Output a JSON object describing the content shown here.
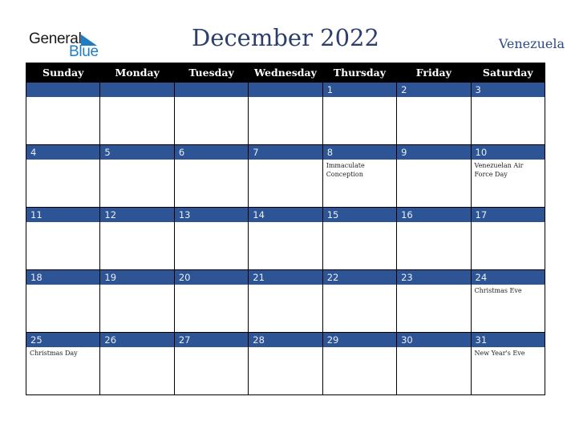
{
  "logo": {
    "line1": "General",
    "line2": "Blue"
  },
  "header": {
    "title": "December 2022",
    "country": "Venezuela"
  },
  "weekdays": [
    "Sunday",
    "Monday",
    "Tuesday",
    "Wednesday",
    "Thursday",
    "Friday",
    "Saturday"
  ],
  "weeks": [
    [
      {
        "day": "",
        "note": ""
      },
      {
        "day": "",
        "note": ""
      },
      {
        "day": "",
        "note": ""
      },
      {
        "day": "",
        "note": ""
      },
      {
        "day": "1",
        "note": ""
      },
      {
        "day": "2",
        "note": ""
      },
      {
        "day": "3",
        "note": ""
      }
    ],
    [
      {
        "day": "4",
        "note": ""
      },
      {
        "day": "5",
        "note": ""
      },
      {
        "day": "6",
        "note": ""
      },
      {
        "day": "7",
        "note": ""
      },
      {
        "day": "8",
        "note": "Immaculate Conception"
      },
      {
        "day": "9",
        "note": ""
      },
      {
        "day": "10",
        "note": "Venezuelan Air Force Day"
      }
    ],
    [
      {
        "day": "11",
        "note": ""
      },
      {
        "day": "12",
        "note": ""
      },
      {
        "day": "13",
        "note": ""
      },
      {
        "day": "14",
        "note": ""
      },
      {
        "day": "15",
        "note": ""
      },
      {
        "day": "16",
        "note": ""
      },
      {
        "day": "17",
        "note": ""
      }
    ],
    [
      {
        "day": "18",
        "note": ""
      },
      {
        "day": "19",
        "note": ""
      },
      {
        "day": "20",
        "note": ""
      },
      {
        "day": "21",
        "note": ""
      },
      {
        "day": "22",
        "note": ""
      },
      {
        "day": "23",
        "note": ""
      },
      {
        "day": "24",
        "note": "Christmas Eve"
      }
    ],
    [
      {
        "day": "25",
        "note": "Christmas Day"
      },
      {
        "day": "26",
        "note": ""
      },
      {
        "day": "27",
        "note": ""
      },
      {
        "day": "28",
        "note": ""
      },
      {
        "day": "29",
        "note": ""
      },
      {
        "day": "30",
        "note": ""
      },
      {
        "day": "31",
        "note": "New Year's Eve"
      }
    ]
  ],
  "colors": {
    "header_bg": "#000000",
    "day_bar": "#2d5596",
    "title": "#2c3e6e",
    "logo_blue": "#1f7dc4"
  }
}
